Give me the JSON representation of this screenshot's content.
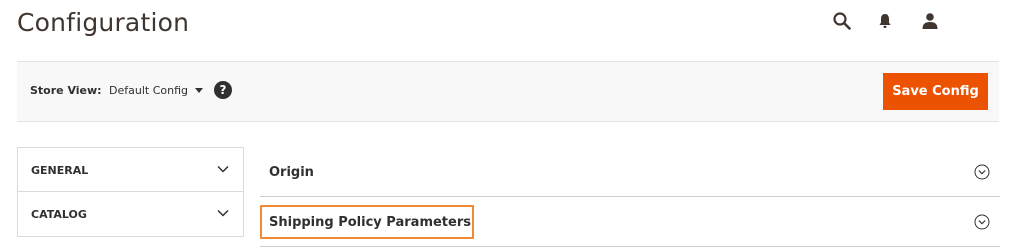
{
  "page": {
    "title": "Configuration"
  },
  "header": {
    "icons": [
      "search-icon",
      "bell-icon",
      "user-icon"
    ]
  },
  "store_bar": {
    "label": "Store View:",
    "selected_scope": "Default Config",
    "help_glyph": "?",
    "save_label": "Save Config"
  },
  "sidebar": {
    "items": [
      {
        "label": "GENERAL"
      },
      {
        "label": "CATALOG"
      }
    ]
  },
  "sections": [
    {
      "title": "Origin"
    },
    {
      "title": "Shipping Policy Parameters"
    }
  ],
  "colors": {
    "accent": "#eb5202",
    "highlight": "#f08a34",
    "title_text": "#41362f"
  }
}
